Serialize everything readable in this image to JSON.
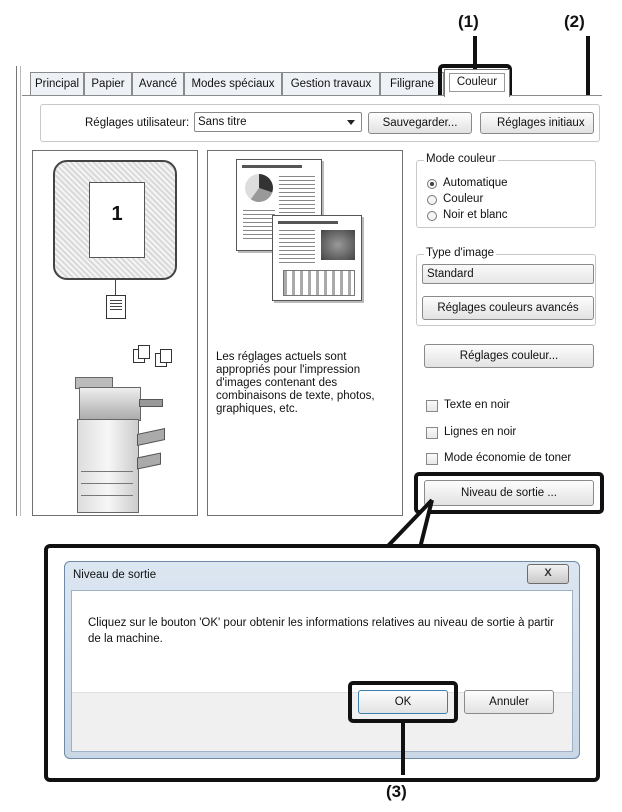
{
  "callouts": {
    "c1": "(1)",
    "c2": "(2)",
    "c3": "(3)"
  },
  "tabs": [
    {
      "label": "Principal"
    },
    {
      "label": "Papier"
    },
    {
      "label": "Avancé"
    },
    {
      "label": "Modes spéciaux"
    },
    {
      "label": "Gestion travaux"
    },
    {
      "label": "Filigrane"
    },
    {
      "label": "Couleur"
    }
  ],
  "user_settings": {
    "label": "Réglages utilisateur:",
    "value": "Sans titre",
    "save_button": "Sauvegarder...",
    "initial_button": "Réglages initiaux"
  },
  "preview": {
    "page_number": "1",
    "description": "Les réglages actuels sont appropriés pour l'impression d'images contenant des combinaisons de texte, photos, graphiques, etc."
  },
  "color_mode": {
    "legend": "Mode couleur",
    "options": [
      "Automatique",
      "Couleur",
      "Noir et blanc"
    ],
    "selected": "Automatique"
  },
  "image_type": {
    "legend": "Type d'image",
    "value": "Standard",
    "advanced_button": "Réglages couleurs avancés"
  },
  "color_settings_button": "Réglages couleur...",
  "checkboxes": [
    "Texte en noir",
    "Lignes en noir",
    "Mode économie de toner"
  ],
  "output_level_button": "Niveau de sortie ...",
  "dialog": {
    "title": "Niveau de sortie",
    "close_glyph": "X",
    "message": "Cliquez sur le bouton 'OK' pour obtenir les informations relatives au niveau de sortie à partir de la machine.",
    "ok": "OK",
    "cancel": "Annuler"
  }
}
